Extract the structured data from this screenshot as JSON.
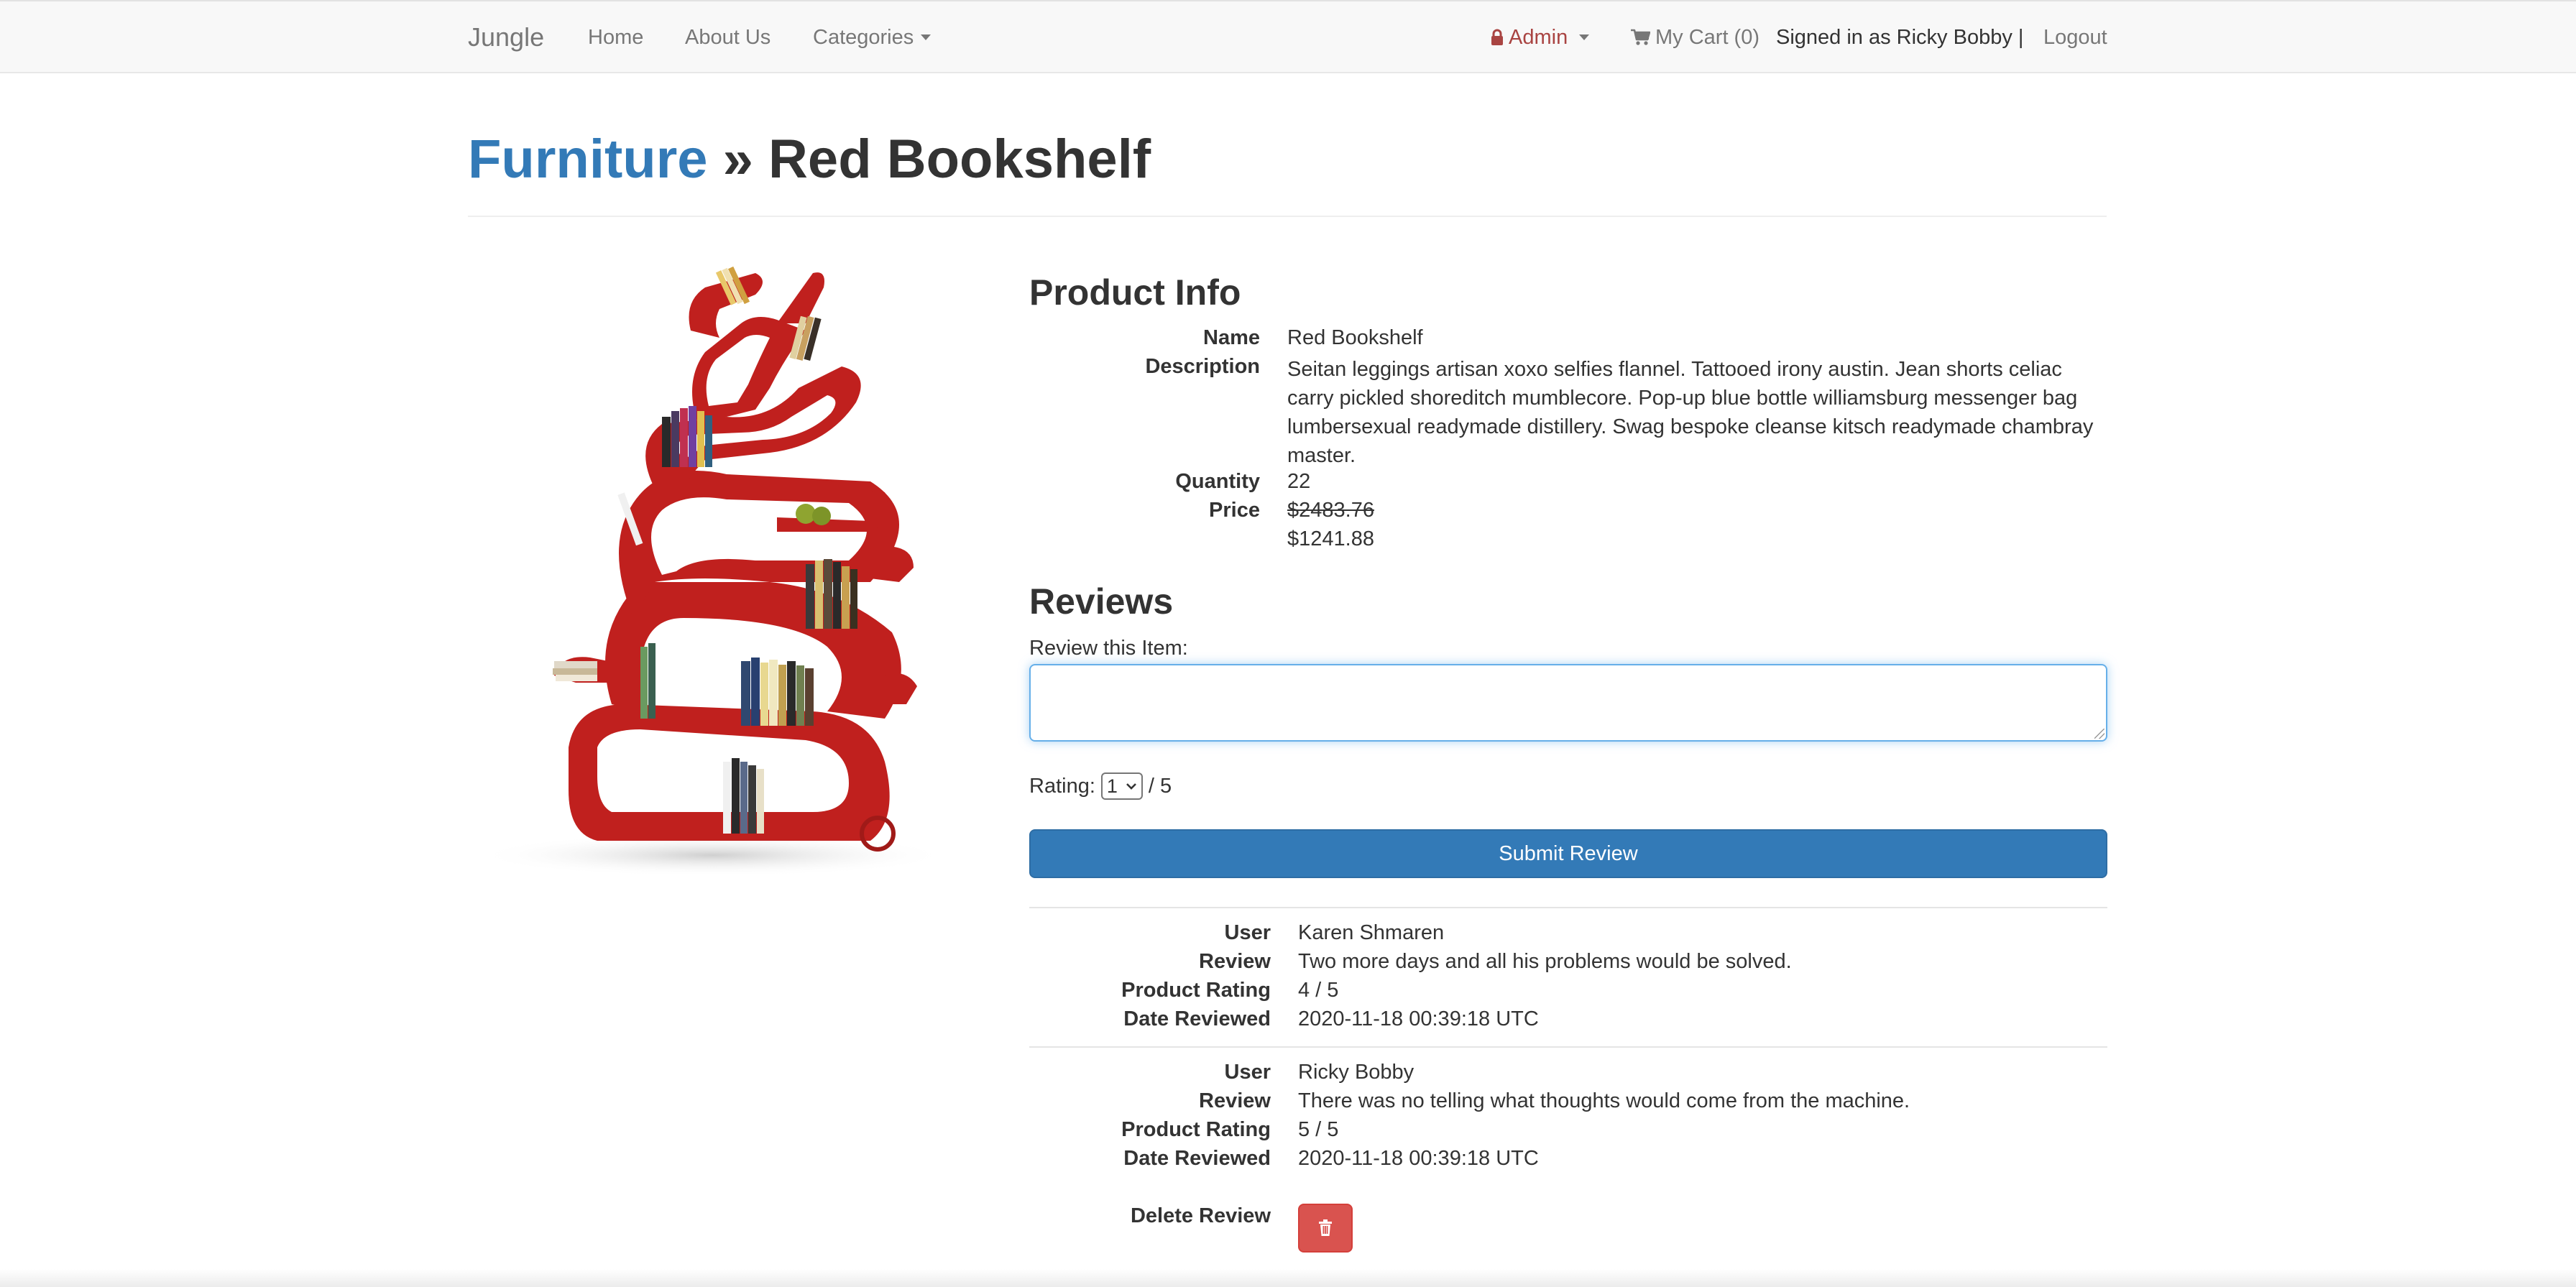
{
  "navbar": {
    "brand": "Jungle",
    "home": "Home",
    "about": "About Us",
    "categories": "Categories",
    "admin": "Admin",
    "cart": "My Cart (0)",
    "signed_in": "Signed in as Ricky Bobby |",
    "logout": "Logout"
  },
  "header": {
    "category": "Furniture",
    "separator": " » ",
    "product": "Red Bookshelf"
  },
  "product_info": {
    "heading": "Product Info",
    "name_label": "Name",
    "name": "Red Bookshelf",
    "description_label": "Description",
    "description": "Seitan leggings artisan xoxo selfies flannel. Tattooed irony austin. Jean shorts celiac carry pickled shoreditch mumblecore. Pop-up blue bottle williamsburg messenger bag lumbersexual readymade distillery. Swag bespoke cleanse kitsch readymade chambray master.",
    "quantity_label": "Quantity",
    "quantity": "22",
    "price_label": "Price",
    "original_price": "$2483.76",
    "sale_price": "$1241.88"
  },
  "reviews": {
    "heading": "Reviews",
    "form_label": "Review this Item:",
    "textarea_value": "",
    "rating_label": "Rating:",
    "rating_selected": "1",
    "rating_suffix": "/ 5",
    "submit_label": "Submit Review",
    "labels": {
      "user": "User",
      "review": "Review",
      "rating": "Product Rating",
      "date": "Date Reviewed",
      "delete": "Delete Review"
    },
    "items": [
      {
        "user": "Karen Shmaren",
        "review": "Two more days and all his problems would be solved.",
        "rating": "4 / 5",
        "date": "2020-11-18 00:39:18 UTC"
      },
      {
        "user": "Ricky Bobby",
        "review": "There was no telling what thoughts would come from the machine.",
        "rating": "5 / 5",
        "date": "2020-11-18 00:39:18 UTC"
      }
    ]
  },
  "icons": {
    "lock": "lock-icon",
    "cart": "shopping-cart-icon",
    "trash": "trash-icon",
    "caret": "caret-down-icon"
  },
  "colors": {
    "link": "#337ab7",
    "admin": "#a94442",
    "primary_button": "#337ab7",
    "danger_button": "#d9534f",
    "bookshelf": "#c0201e"
  }
}
